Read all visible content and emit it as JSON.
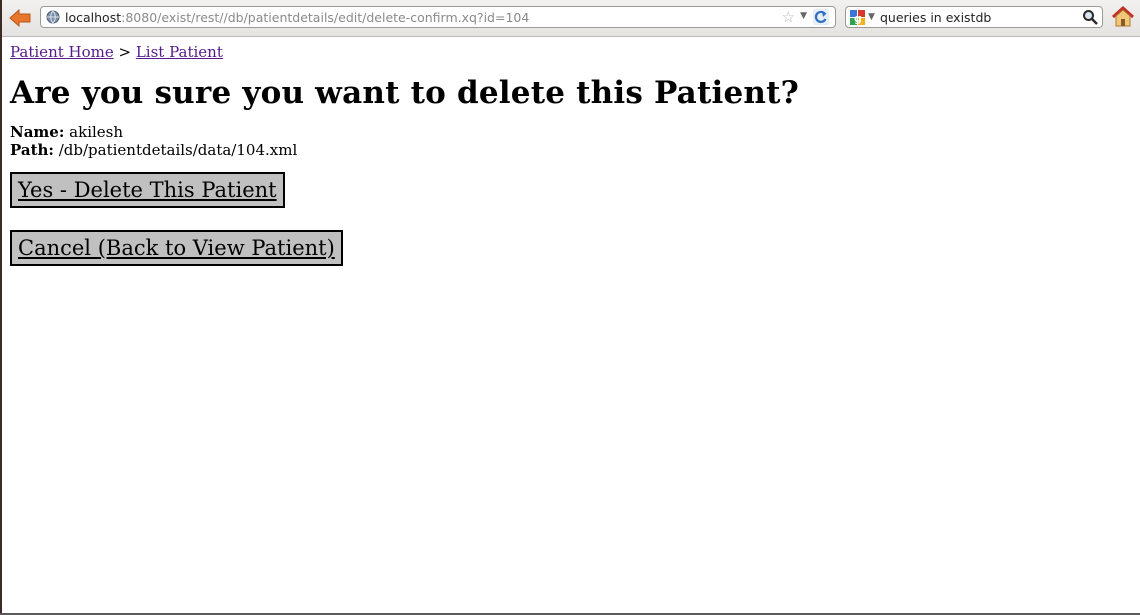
{
  "browser": {
    "url_host": "localhost",
    "url_rest": ":8080/exist/rest//db/patientdetails/edit/delete-confirm.xq?id=104",
    "search_text": "queries in existdb"
  },
  "breadcrumb": {
    "home": "Patient Home",
    "separator": " > ",
    "list": "List Patient"
  },
  "page": {
    "title": "Are you sure you want to delete this Patient?",
    "name_label": "Name:",
    "name_value": "akilesh",
    "path_label": "Path:",
    "path_value": "/db/patientdetails/data/104.xml",
    "delete_button": "Yes - Delete This Patient",
    "cancel_button": "Cancel (Back to View Patient)"
  },
  "icons": {
    "back": "back-arrow-icon",
    "globe": "globe-icon",
    "star": "star-icon",
    "reload": "reload-icon",
    "google": "google-icon",
    "search": "search-icon",
    "home": "home-icon"
  },
  "colors": {
    "link_visited": "#551a8b",
    "button_bg": "#c0c0c0",
    "back_arrow": "#e8762b",
    "home_roof": "#d9372d"
  }
}
